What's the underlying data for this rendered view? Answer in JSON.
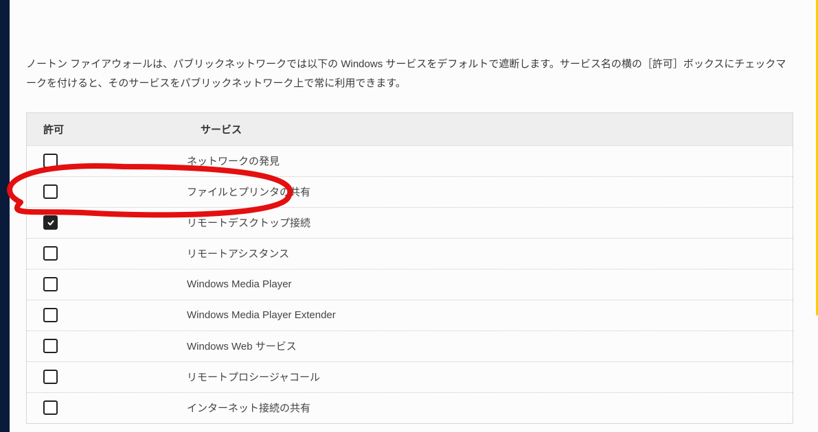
{
  "intro": "ノートン ファイアウォールは、パブリックネットワークでは以下の Windows サービスをデフォルトで遮断します。サービス名の横の［許可］ボックスにチェックマークを付けると、そのサービスをパブリックネットワーク上で常に利用できます。",
  "headers": {
    "allow": "許可",
    "service": "サービス"
  },
  "services": [
    {
      "allowed": false,
      "name": "ネットワークの発見"
    },
    {
      "allowed": false,
      "name": "ファイルとプリンタの共有"
    },
    {
      "allowed": true,
      "name": "リモートデスクトップ接続"
    },
    {
      "allowed": false,
      "name": "リモートアシスタンス"
    },
    {
      "allowed": false,
      "name": "Windows Media Player"
    },
    {
      "allowed": false,
      "name": "Windows Media Player Extender"
    },
    {
      "allowed": false,
      "name": "Windows Web サービス"
    },
    {
      "allowed": false,
      "name": "リモートプロシージャコール"
    },
    {
      "allowed": false,
      "name": "インターネット接続の共有"
    }
  ],
  "annotation": {
    "color": "#e40f0f",
    "highlighted_index": 2
  }
}
